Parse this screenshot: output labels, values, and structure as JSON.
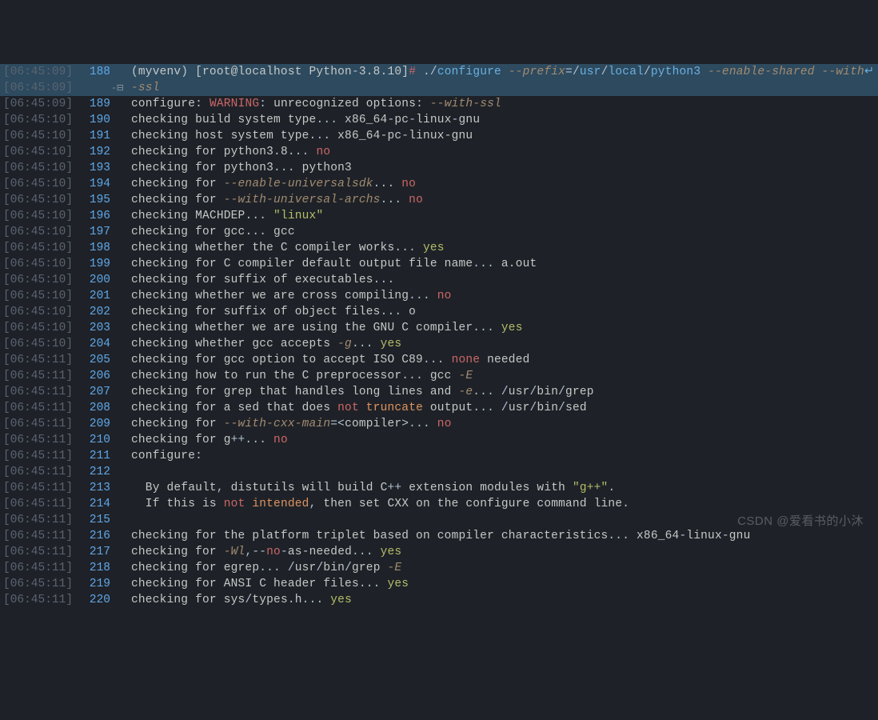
{
  "watermark": "CSDN @爱看书的小沐",
  "lines": [
    {
      "ts": "[06:45:09]",
      "ln": "188",
      "fold": "",
      "hl": true,
      "segs": [
        {
          "t": "(myvenv) [root@localhost Python",
          "c": "pale"
        },
        {
          "t": "-",
          "c": "pu"
        },
        {
          "t": "3.8.10",
          "c": "pale"
        },
        {
          "t": "]",
          "c": "pale"
        },
        {
          "t": "#",
          "c": "hash"
        },
        {
          "t": " .",
          "c": "pale"
        },
        {
          "t": "/",
          "c": "pu"
        },
        {
          "t": "configure ",
          "c": "cmd"
        },
        {
          "t": "--prefix",
          "c": "opt"
        },
        {
          "t": "=/",
          "c": "pu"
        },
        {
          "t": "usr",
          "c": "cmd"
        },
        {
          "t": "/",
          "c": "pu"
        },
        {
          "t": "local",
          "c": "cmd"
        },
        {
          "t": "/",
          "c": "pu"
        },
        {
          "t": "python3 ",
          "c": "cmd"
        },
        {
          "t": "--enable-shared --with",
          "c": "opt"
        },
        {
          "t": "↵",
          "c": "wrap"
        }
      ]
    },
    {
      "ts": "[06:45:09]",
      "ln": "",
      "fold": "-⊟",
      "hl": true,
      "segs": [
        {
          "t": "-ssl",
          "c": "opt"
        }
      ]
    },
    {
      "ts": "[06:45:09]",
      "ln": "189",
      "segs": [
        {
          "t": "configure",
          "c": "pale"
        },
        {
          "t": ": ",
          "c": "pu"
        },
        {
          "t": "WARNING",
          "c": "red"
        },
        {
          "t": ": ",
          "c": "pu"
        },
        {
          "t": "unrecognized options",
          "c": "pale"
        },
        {
          "t": ": ",
          "c": "pu"
        },
        {
          "t": "--with-ssl",
          "c": "opt"
        }
      ]
    },
    {
      "ts": "[06:45:10]",
      "ln": "190",
      "segs": [
        {
          "t": "checking build system type",
          "c": "pale"
        },
        {
          "t": "... ",
          "c": "pu"
        },
        {
          "t": "x86_64",
          "c": "pale"
        },
        {
          "t": "-",
          "c": "pu"
        },
        {
          "t": "pc",
          "c": "pale"
        },
        {
          "t": "-",
          "c": "pu"
        },
        {
          "t": "linux",
          "c": "pale"
        },
        {
          "t": "-",
          "c": "pu"
        },
        {
          "t": "gnu",
          "c": "pale"
        }
      ]
    },
    {
      "ts": "[06:45:10]",
      "ln": "191",
      "segs": [
        {
          "t": "checking host system type",
          "c": "pale"
        },
        {
          "t": "... ",
          "c": "pu"
        },
        {
          "t": "x86_64",
          "c": "pale"
        },
        {
          "t": "-",
          "c": "pu"
        },
        {
          "t": "pc",
          "c": "pale"
        },
        {
          "t": "-",
          "c": "pu"
        },
        {
          "t": "linux",
          "c": "pale"
        },
        {
          "t": "-",
          "c": "pu"
        },
        {
          "t": "gnu",
          "c": "pale"
        }
      ]
    },
    {
      "ts": "[06:45:10]",
      "ln": "192",
      "segs": [
        {
          "t": "checking for python3",
          "c": "pale"
        },
        {
          "t": ".",
          "c": "pu"
        },
        {
          "t": "8",
          "c": "pale"
        },
        {
          "t": "... ",
          "c": "pu"
        },
        {
          "t": "no",
          "c": "no"
        }
      ]
    },
    {
      "ts": "[06:45:10]",
      "ln": "193",
      "segs": [
        {
          "t": "checking for python3",
          "c": "pale"
        },
        {
          "t": "... ",
          "c": "pu"
        },
        {
          "t": "python3",
          "c": "pale"
        }
      ]
    },
    {
      "ts": "[06:45:10]",
      "ln": "194",
      "segs": [
        {
          "t": "checking for ",
          "c": "pale"
        },
        {
          "t": "--enable-universalsdk",
          "c": "opt"
        },
        {
          "t": "... ",
          "c": "pu"
        },
        {
          "t": "no",
          "c": "no"
        }
      ]
    },
    {
      "ts": "[06:45:10]",
      "ln": "195",
      "segs": [
        {
          "t": "checking for ",
          "c": "pale"
        },
        {
          "t": "--with-universal-archs",
          "c": "opt"
        },
        {
          "t": "... ",
          "c": "pu"
        },
        {
          "t": "no",
          "c": "no"
        }
      ]
    },
    {
      "ts": "[06:45:10]",
      "ln": "196",
      "segs": [
        {
          "t": "checking MACHDEP",
          "c": "pale"
        },
        {
          "t": "... ",
          "c": "pu"
        },
        {
          "t": "\"linux\"",
          "c": "str"
        }
      ]
    },
    {
      "ts": "[06:45:10]",
      "ln": "197",
      "segs": [
        {
          "t": "checking for gcc",
          "c": "pale"
        },
        {
          "t": "... ",
          "c": "pu"
        },
        {
          "t": "gcc",
          "c": "pale"
        }
      ]
    },
    {
      "ts": "[06:45:10]",
      "ln": "198",
      "segs": [
        {
          "t": "checking whether the C compiler works",
          "c": "pale"
        },
        {
          "t": "... ",
          "c": "pu"
        },
        {
          "t": "yes",
          "c": "yes"
        }
      ]
    },
    {
      "ts": "[06:45:10]",
      "ln": "199",
      "segs": [
        {
          "t": "checking for C compiler default output file name",
          "c": "pale"
        },
        {
          "t": "... ",
          "c": "pu"
        },
        {
          "t": "a",
          "c": "pale"
        },
        {
          "t": ".",
          "c": "pu"
        },
        {
          "t": "out",
          "c": "pale"
        }
      ]
    },
    {
      "ts": "[06:45:10]",
      "ln": "200",
      "segs": [
        {
          "t": "checking for suffix of executables",
          "c": "pale"
        },
        {
          "t": "... ",
          "c": "pu"
        }
      ]
    },
    {
      "ts": "[06:45:10]",
      "ln": "201",
      "segs": [
        {
          "t": "checking whether we are cross compiling",
          "c": "pale"
        },
        {
          "t": "... ",
          "c": "pu"
        },
        {
          "t": "no",
          "c": "no"
        }
      ]
    },
    {
      "ts": "[06:45:10]",
      "ln": "202",
      "segs": [
        {
          "t": "checking for suffix of object files",
          "c": "pale"
        },
        {
          "t": "... ",
          "c": "pu"
        },
        {
          "t": "o",
          "c": "pale"
        }
      ]
    },
    {
      "ts": "[06:45:10]",
      "ln": "203",
      "segs": [
        {
          "t": "checking whether we are using the GNU C compiler",
          "c": "pale"
        },
        {
          "t": "... ",
          "c": "pu"
        },
        {
          "t": "yes",
          "c": "yes"
        }
      ]
    },
    {
      "ts": "[06:45:10]",
      "ln": "204",
      "segs": [
        {
          "t": "checking whether gcc accepts ",
          "c": "pale"
        },
        {
          "t": "-g",
          "c": "opt"
        },
        {
          "t": "... ",
          "c": "pu"
        },
        {
          "t": "yes",
          "c": "yes"
        }
      ]
    },
    {
      "ts": "[06:45:11]",
      "ln": "205",
      "segs": [
        {
          "t": "checking for gcc option to accept ISO C89",
          "c": "pale"
        },
        {
          "t": "... ",
          "c": "pu"
        },
        {
          "t": "none",
          "c": "none"
        },
        {
          "t": " needed",
          "c": "pale"
        }
      ]
    },
    {
      "ts": "[06:45:11]",
      "ln": "206",
      "segs": [
        {
          "t": "checking how to run the C preprocessor",
          "c": "pale"
        },
        {
          "t": "... ",
          "c": "pu"
        },
        {
          "t": "gcc ",
          "c": "pale"
        },
        {
          "t": "-E",
          "c": "opt"
        }
      ]
    },
    {
      "ts": "[06:45:11]",
      "ln": "207",
      "segs": [
        {
          "t": "checking for grep that handles long lines and ",
          "c": "pale"
        },
        {
          "t": "-e",
          "c": "opt"
        },
        {
          "t": "... /",
          "c": "pu"
        },
        {
          "t": "usr",
          "c": "pale"
        },
        {
          "t": "/",
          "c": "pu"
        },
        {
          "t": "bin",
          "c": "pale"
        },
        {
          "t": "/",
          "c": "pu"
        },
        {
          "t": "grep",
          "c": "pale"
        }
      ]
    },
    {
      "ts": "[06:45:11]",
      "ln": "208",
      "segs": [
        {
          "t": "checking for a sed that does ",
          "c": "pale"
        },
        {
          "t": "not",
          "c": "red"
        },
        {
          "t": " ",
          "c": "pale"
        },
        {
          "t": "truncate",
          "c": "orange"
        },
        {
          "t": " output",
          "c": "pale"
        },
        {
          "t": "... /",
          "c": "pu"
        },
        {
          "t": "usr",
          "c": "pale"
        },
        {
          "t": "/",
          "c": "pu"
        },
        {
          "t": "bin",
          "c": "pale"
        },
        {
          "t": "/",
          "c": "pu"
        },
        {
          "t": "sed",
          "c": "pale"
        }
      ]
    },
    {
      "ts": "[06:45:11]",
      "ln": "209",
      "segs": [
        {
          "t": "checking for ",
          "c": "pale"
        },
        {
          "t": "--with-cxx-main",
          "c": "opt"
        },
        {
          "t": "=<",
          "c": "pu"
        },
        {
          "t": "compiler",
          "c": "pale"
        },
        {
          "t": ">... ",
          "c": "pu"
        },
        {
          "t": "no",
          "c": "no"
        }
      ]
    },
    {
      "ts": "[06:45:11]",
      "ln": "210",
      "segs": [
        {
          "t": "checking for g",
          "c": "pale"
        },
        {
          "t": "++... ",
          "c": "pu"
        },
        {
          "t": "no",
          "c": "no"
        }
      ]
    },
    {
      "ts": "[06:45:11]",
      "ln": "211",
      "segs": [
        {
          "t": "configure",
          "c": "pale"
        },
        {
          "t": ":",
          "c": "pu"
        }
      ]
    },
    {
      "ts": "[06:45:11]",
      "ln": "212",
      "segs": [
        {
          "t": "",
          "c": "pale"
        }
      ]
    },
    {
      "ts": "[06:45:11]",
      "ln": "213",
      "segs": [
        {
          "t": "  By default",
          "c": "pale"
        },
        {
          "t": ", ",
          "c": "pu"
        },
        {
          "t": "distutils will build C",
          "c": "pale"
        },
        {
          "t": "++ ",
          "c": "pu"
        },
        {
          "t": "extension modules with ",
          "c": "pale"
        },
        {
          "t": "\"g++\"",
          "c": "str"
        },
        {
          "t": ".",
          "c": "pu"
        }
      ]
    },
    {
      "ts": "[06:45:11]",
      "ln": "214",
      "segs": [
        {
          "t": "  If this is ",
          "c": "pale"
        },
        {
          "t": "not",
          "c": "red"
        },
        {
          "t": " ",
          "c": "pale"
        },
        {
          "t": "intended",
          "c": "orange"
        },
        {
          "t": ", ",
          "c": "pu"
        },
        {
          "t": "then set CXX on the configure command line",
          "c": "pale"
        },
        {
          "t": ".",
          "c": "pu"
        }
      ]
    },
    {
      "ts": "[06:45:11]",
      "ln": "215",
      "segs": [
        {
          "t": "",
          "c": "pale"
        }
      ]
    },
    {
      "ts": "[06:45:11]",
      "ln": "216",
      "segs": [
        {
          "t": "checking for the platform triplet based on compiler characteristics",
          "c": "pale"
        },
        {
          "t": "... ",
          "c": "pu"
        },
        {
          "t": "x86_64",
          "c": "pale"
        },
        {
          "t": "-",
          "c": "pu"
        },
        {
          "t": "linux",
          "c": "pale"
        },
        {
          "t": "-",
          "c": "pu"
        },
        {
          "t": "gnu",
          "c": "pale"
        }
      ]
    },
    {
      "ts": "[06:45:11]",
      "ln": "217",
      "segs": [
        {
          "t": "checking for ",
          "c": "pale"
        },
        {
          "t": "-Wl",
          "c": "opt"
        },
        {
          "t": ",--",
          "c": "pu"
        },
        {
          "t": "no",
          "c": "no"
        },
        {
          "t": "-",
          "c": "pu"
        },
        {
          "t": "as",
          "c": "pale"
        },
        {
          "t": "-",
          "c": "pu"
        },
        {
          "t": "needed",
          "c": "pale"
        },
        {
          "t": "... ",
          "c": "pu"
        },
        {
          "t": "yes",
          "c": "yes"
        }
      ]
    },
    {
      "ts": "[06:45:11]",
      "ln": "218",
      "segs": [
        {
          "t": "checking for egrep",
          "c": "pale"
        },
        {
          "t": "... /",
          "c": "pu"
        },
        {
          "t": "usr",
          "c": "pale"
        },
        {
          "t": "/",
          "c": "pu"
        },
        {
          "t": "bin",
          "c": "pale"
        },
        {
          "t": "/",
          "c": "pu"
        },
        {
          "t": "grep ",
          "c": "pale"
        },
        {
          "t": "-E",
          "c": "opt"
        }
      ]
    },
    {
      "ts": "[06:45:11]",
      "ln": "219",
      "segs": [
        {
          "t": "checking for ANSI C header files",
          "c": "pale"
        },
        {
          "t": "... ",
          "c": "pu"
        },
        {
          "t": "yes",
          "c": "yes"
        }
      ]
    },
    {
      "ts": "[06:45:11]",
      "ln": "220",
      "segs": [
        {
          "t": "checking for sys",
          "c": "pale"
        },
        {
          "t": "/",
          "c": "pu"
        },
        {
          "t": "types",
          "c": "pale"
        },
        {
          "t": ".",
          "c": "pu"
        },
        {
          "t": "h",
          "c": "pale"
        },
        {
          "t": "... ",
          "c": "pu"
        },
        {
          "t": "yes",
          "c": "yes"
        }
      ]
    }
  ]
}
